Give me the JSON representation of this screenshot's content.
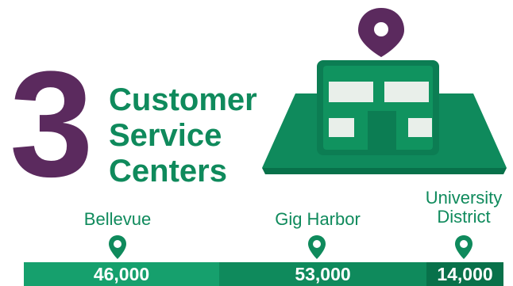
{
  "big_number": "3",
  "headline": [
    "Customer",
    "Service",
    "Centers"
  ],
  "colors": {
    "purple": "#5b2a5e",
    "green": "#0f8a5c",
    "green_dark": "#08714a",
    "green_light": "#16a06d",
    "building_window": "#e9efea"
  },
  "icons": {
    "marker": "location-pin-icon",
    "building": "service-center-building-icon"
  },
  "centers": [
    {
      "name": "Bellevue",
      "customers": "46,000",
      "value": 46000
    },
    {
      "name": "Gig Harbor",
      "customers": "53,000",
      "value": 53000
    },
    {
      "name": "University District",
      "name_lines": [
        "University",
        "District"
      ],
      "customers": "14,000",
      "value": 14000
    }
  ]
}
